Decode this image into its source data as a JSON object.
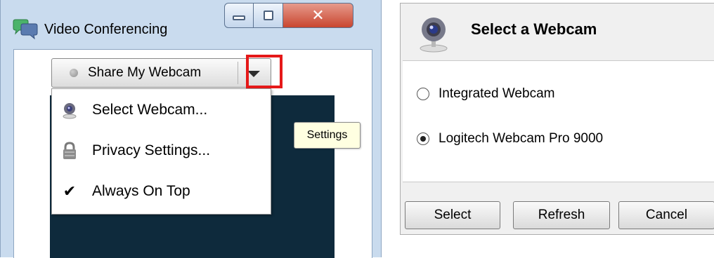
{
  "left_window": {
    "title": "Video Conferencing",
    "caption_buttons": [
      "minimize-icon",
      "maximize-icon",
      "close-icon"
    ],
    "share_button_label": "Share My Webcam",
    "menu": {
      "items": [
        {
          "label": "Select Webcam...",
          "icon": "webcam-icon"
        },
        {
          "label": "Privacy Settings...",
          "icon": "lock-icon"
        },
        {
          "label": "Always On Top",
          "icon": "checkmark-icon",
          "checked": true
        }
      ]
    },
    "tooltip": "Settings",
    "highlight_color": "#e51919",
    "preview_color": "#0e2a3c"
  },
  "right_dialog": {
    "title": "Select a Webcam",
    "options": [
      {
        "label": "Integrated Webcam",
        "selected": false
      },
      {
        "label": "Logitech Webcam Pro 9000",
        "selected": true
      }
    ],
    "buttons": {
      "select": "Select",
      "refresh": "Refresh",
      "cancel": "Cancel"
    }
  }
}
